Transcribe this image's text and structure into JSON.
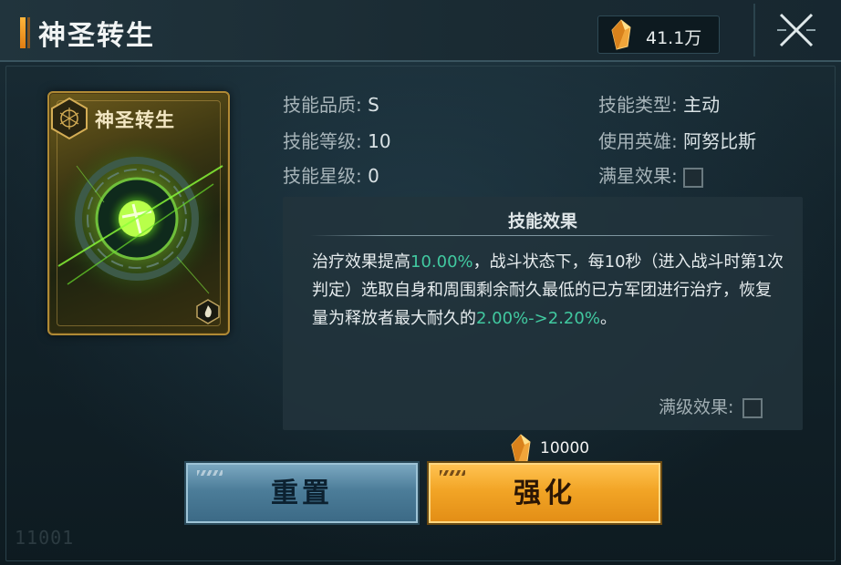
{
  "header": {
    "title": "神圣转生",
    "currency_amount": "41.1万"
  },
  "card": {
    "name": "神圣转生"
  },
  "info": {
    "quality_label": "技能品质:",
    "quality_value": "S",
    "level_label": "技能等级:",
    "level_value": "10",
    "star_label": "技能星级:",
    "star_value": "0",
    "type_label": "技能类型:",
    "type_value": "主动",
    "hero_label": "使用英雄:",
    "hero_value": "阿努比斯",
    "full_star_label": "满星效果:"
  },
  "effect": {
    "title": "技能效果",
    "text_part1": "治疗效果提高",
    "text_hl1": "10.00%",
    "text_part2": "，战斗状态下，每10秒（进入战斗时第1次判定）选取自身和周围剩余耐久最低的已方军团进行治疗，恢复量为释放者最大耐久的",
    "text_hl2": "2.00%->2.20%",
    "text_part3": "。",
    "max_level_label": "满级效果:"
  },
  "cost": {
    "amount": "10000"
  },
  "buttons": {
    "reset_label": "重置",
    "enhance_label": "强化"
  },
  "watermark": "11001",
  "colors": {
    "highlight": "#41c9a0",
    "accent_orange": "#f2a526",
    "accent_blue": "#4c7d99"
  }
}
